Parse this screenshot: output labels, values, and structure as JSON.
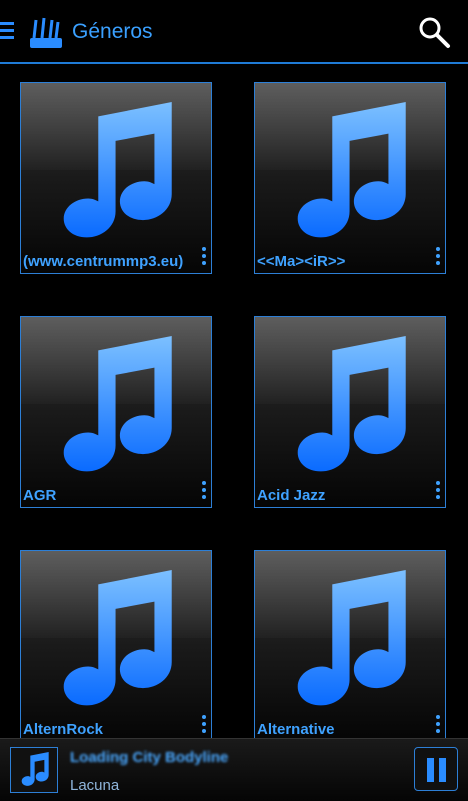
{
  "header": {
    "title": "Géneros"
  },
  "genres": [
    {
      "label": "(www.centrummp3.eu)"
    },
    {
      "label": "<<Ma><iR>>"
    },
    {
      "label": "AGR"
    },
    {
      "label": "Acid Jazz"
    },
    {
      "label": "AlternRock"
    },
    {
      "label": "Alternative"
    }
  ],
  "player": {
    "song": "Loading City Bodyline",
    "artist": "Lacuna"
  },
  "colors": {
    "accent": "#2a8cff",
    "background": "#000000"
  },
  "icons": {
    "menu": "menu-icon",
    "app": "guitar-app-icon",
    "search": "search-icon",
    "note": "music-note-icon",
    "more": "more-vert-icon",
    "pause": "pause-icon"
  }
}
